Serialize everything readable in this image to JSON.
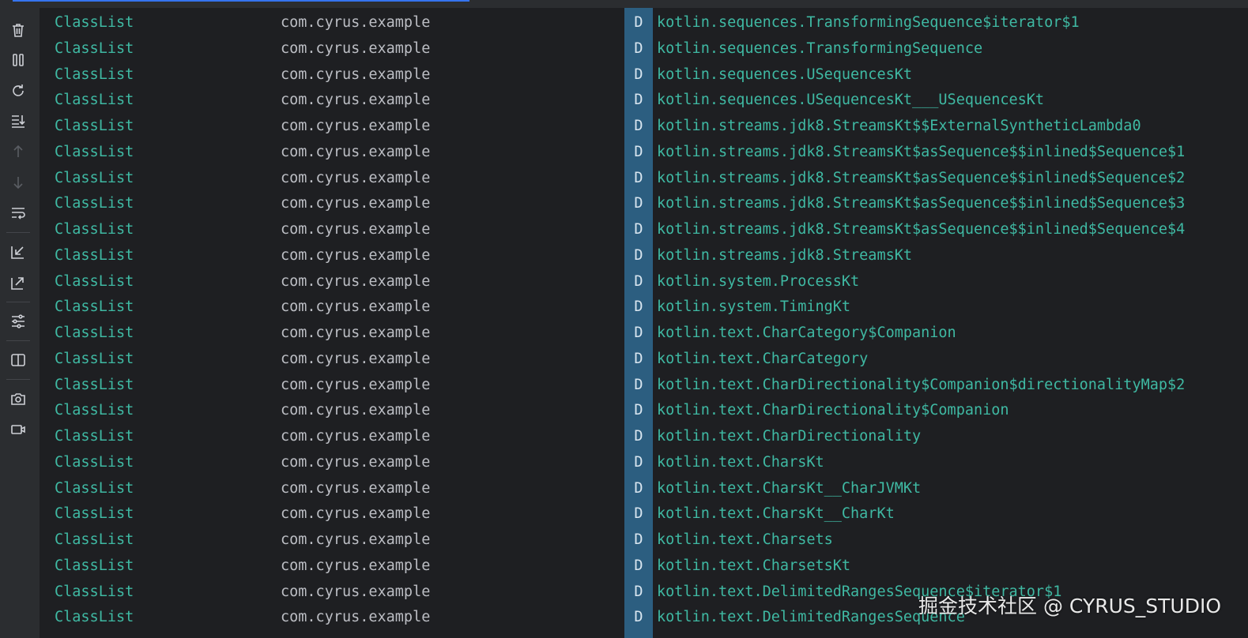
{
  "colors": {
    "background": "#1e1f22",
    "toolbar": "#2b2d30",
    "level_strip": "#2c5e80",
    "tag_text": "#3fb9a3",
    "package_text": "#bcbec4",
    "message_text": "#3fb9a3",
    "accent": "#3574f0"
  },
  "toolbar": {
    "icons": [
      "trash-icon",
      "pause-icon",
      "restart-icon",
      "scroll-to-end-icon",
      "arrow-up-icon",
      "arrow-down-icon",
      "soft-wrap-icon",
      "import-icon",
      "export-icon",
      "filter-settings-icon",
      "split-view-icon",
      "screenshot-icon",
      "screen-record-icon"
    ]
  },
  "log": {
    "rows": [
      {
        "tag": "ClassList",
        "package": "com.cyrus.example",
        "level": "D",
        "message": "kotlin.sequences.TransformingSequence$iterator$1"
      },
      {
        "tag": "ClassList",
        "package": "com.cyrus.example",
        "level": "D",
        "message": "kotlin.sequences.TransformingSequence"
      },
      {
        "tag": "ClassList",
        "package": "com.cyrus.example",
        "level": "D",
        "message": "kotlin.sequences.USequencesKt"
      },
      {
        "tag": "ClassList",
        "package": "com.cyrus.example",
        "level": "D",
        "message": "kotlin.sequences.USequencesKt___USequencesKt"
      },
      {
        "tag": "ClassList",
        "package": "com.cyrus.example",
        "level": "D",
        "message": "kotlin.streams.jdk8.StreamsKt$$ExternalSyntheticLambda0"
      },
      {
        "tag": "ClassList",
        "package": "com.cyrus.example",
        "level": "D",
        "message": "kotlin.streams.jdk8.StreamsKt$asSequence$$inlined$Sequence$1"
      },
      {
        "tag": "ClassList",
        "package": "com.cyrus.example",
        "level": "D",
        "message": "kotlin.streams.jdk8.StreamsKt$asSequence$$inlined$Sequence$2"
      },
      {
        "tag": "ClassList",
        "package": "com.cyrus.example",
        "level": "D",
        "message": "kotlin.streams.jdk8.StreamsKt$asSequence$$inlined$Sequence$3"
      },
      {
        "tag": "ClassList",
        "package": "com.cyrus.example",
        "level": "D",
        "message": "kotlin.streams.jdk8.StreamsKt$asSequence$$inlined$Sequence$4"
      },
      {
        "tag": "ClassList",
        "package": "com.cyrus.example",
        "level": "D",
        "message": "kotlin.streams.jdk8.StreamsKt"
      },
      {
        "tag": "ClassList",
        "package": "com.cyrus.example",
        "level": "D",
        "message": "kotlin.system.ProcessKt"
      },
      {
        "tag": "ClassList",
        "package": "com.cyrus.example",
        "level": "D",
        "message": "kotlin.system.TimingKt"
      },
      {
        "tag": "ClassList",
        "package": "com.cyrus.example",
        "level": "D",
        "message": "kotlin.text.CharCategory$Companion"
      },
      {
        "tag": "ClassList",
        "package": "com.cyrus.example",
        "level": "D",
        "message": "kotlin.text.CharCategory"
      },
      {
        "tag": "ClassList",
        "package": "com.cyrus.example",
        "level": "D",
        "message": "kotlin.text.CharDirectionality$Companion$directionalityMap$2"
      },
      {
        "tag": "ClassList",
        "package": "com.cyrus.example",
        "level": "D",
        "message": "kotlin.text.CharDirectionality$Companion"
      },
      {
        "tag": "ClassList",
        "package": "com.cyrus.example",
        "level": "D",
        "message": "kotlin.text.CharDirectionality"
      },
      {
        "tag": "ClassList",
        "package": "com.cyrus.example",
        "level": "D",
        "message": "kotlin.text.CharsKt"
      },
      {
        "tag": "ClassList",
        "package": "com.cyrus.example",
        "level": "D",
        "message": "kotlin.text.CharsKt__CharJVMKt"
      },
      {
        "tag": "ClassList",
        "package": "com.cyrus.example",
        "level": "D",
        "message": "kotlin.text.CharsKt__CharKt"
      },
      {
        "tag": "ClassList",
        "package": "com.cyrus.example",
        "level": "D",
        "message": "kotlin.text.Charsets"
      },
      {
        "tag": "ClassList",
        "package": "com.cyrus.example",
        "level": "D",
        "message": "kotlin.text.CharsetsKt"
      },
      {
        "tag": "ClassList",
        "package": "com.cyrus.example",
        "level": "D",
        "message": "kotlin.text.DelimitedRangesSequence$iterator$1"
      },
      {
        "tag": "ClassList",
        "package": "com.cyrus.example",
        "level": "D",
        "message": "kotlin.text.DelimitedRangesSequence"
      }
    ]
  },
  "watermark": {
    "text": "掘金技术社区 @ CYRUS_STUDIO"
  }
}
